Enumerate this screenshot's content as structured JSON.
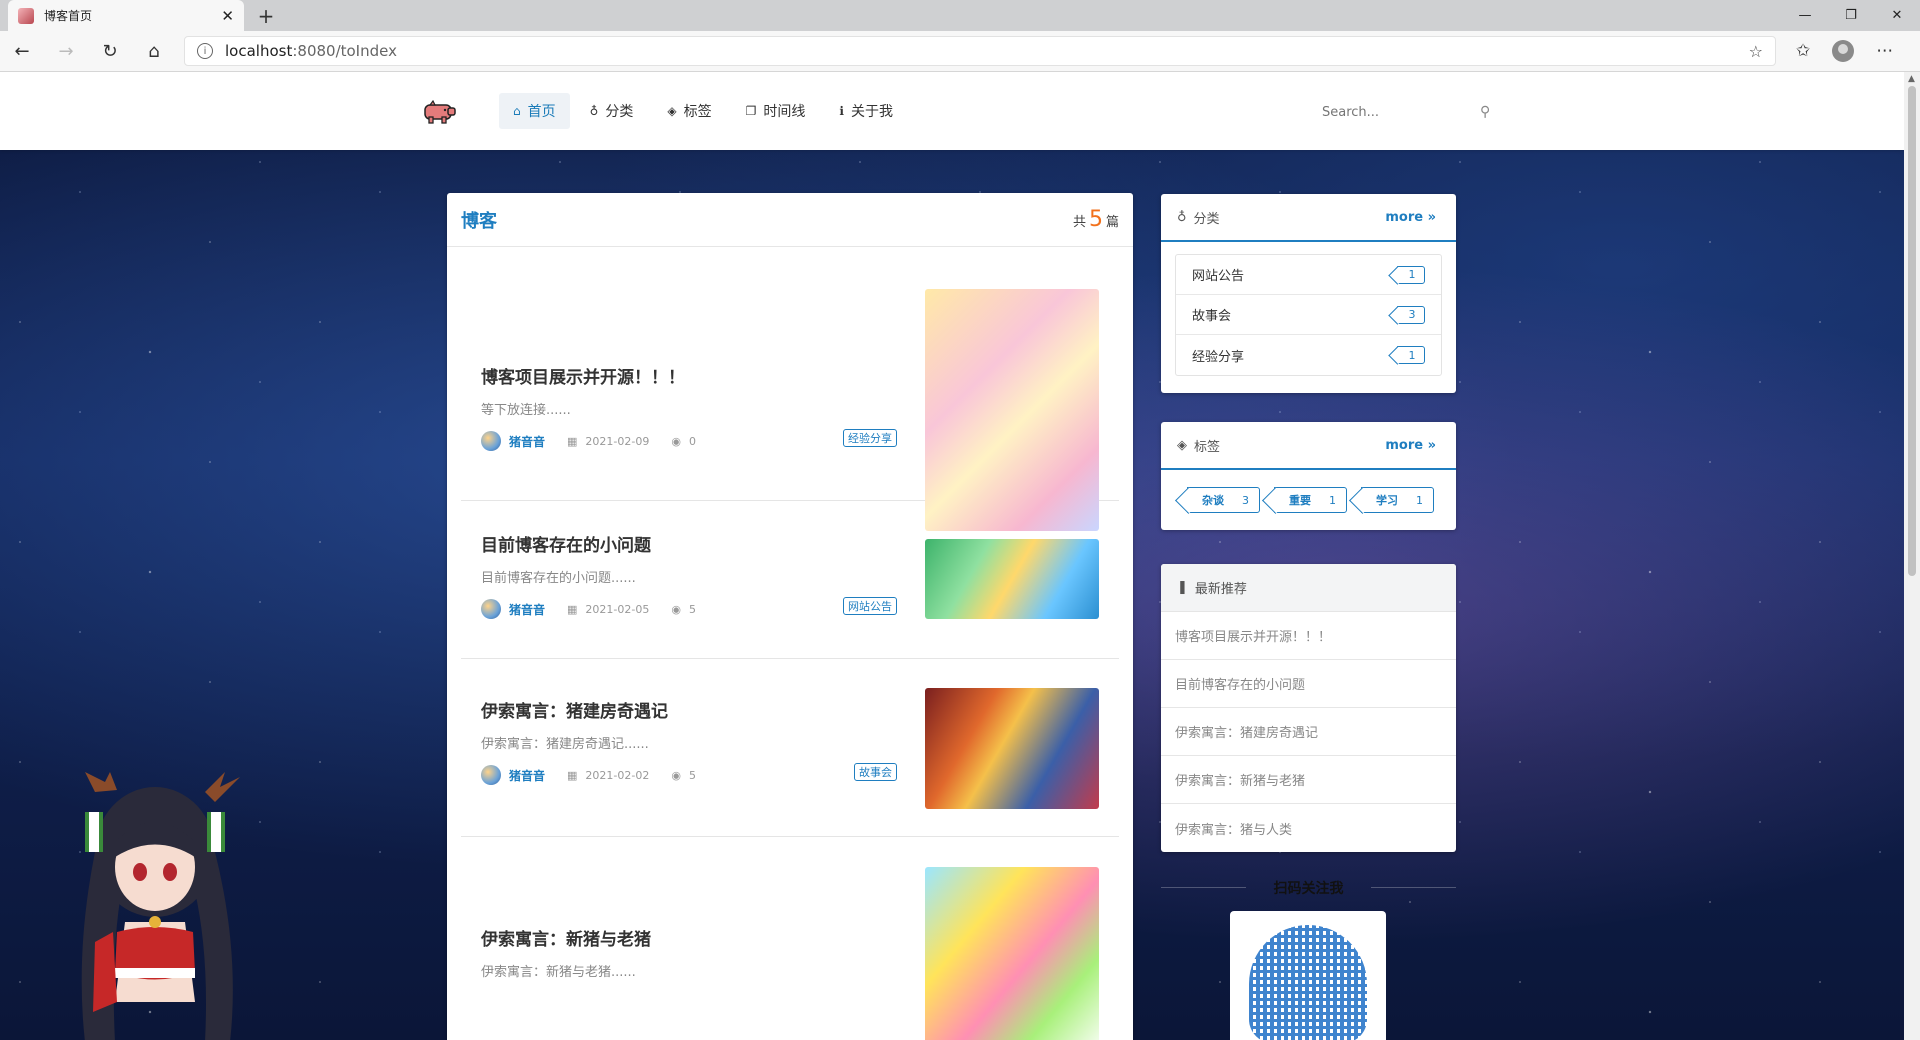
{
  "browser": {
    "tab_title": "博客首页",
    "tab_close": "✕",
    "new_tab": "+",
    "url_host": "localhost",
    "url_path": ":8080/toIndex",
    "controls": {
      "minimize": "—",
      "restore": "❐",
      "close": "✕"
    }
  },
  "nav": {
    "items": [
      {
        "label": "首页",
        "icon": "home-icon",
        "glyph": "⌂",
        "active": true
      },
      {
        "label": "分类",
        "icon": "lightbulb-icon",
        "glyph": "♁",
        "active": false
      },
      {
        "label": "标签",
        "icon": "tags-icon",
        "glyph": "◈",
        "active": false
      },
      {
        "label": "时间线",
        "icon": "clone-icon",
        "glyph": "❐",
        "active": false
      },
      {
        "label": "关于我",
        "icon": "info-icon",
        "glyph": "ℹ",
        "active": false
      }
    ],
    "search_placeholder": "Search..."
  },
  "blog": {
    "title": "博客",
    "count_prefix": "共",
    "count": "5",
    "count_suffix": "篇",
    "posts": [
      {
        "title": "博客项目展示并开源！！！",
        "excerpt": "等下放连接......",
        "author": "猪音音",
        "date": "2021-02-09",
        "views": "0",
        "tag": "经验分享"
      },
      {
        "title": "目前博客存在的小问题",
        "excerpt": "目前博客存在的小问题......",
        "author": "猪音音",
        "date": "2021-02-05",
        "views": "5",
        "tag": "网站公告"
      },
      {
        "title": "伊索寓言：猪建房奇遇记",
        "excerpt": "伊索寓言：猪建房奇遇记......",
        "author": "猪音音",
        "date": "2021-02-02",
        "views": "5",
        "tag": "故事会"
      },
      {
        "title": "伊索寓言：新猪与老猪",
        "excerpt": "伊索寓言：新猪与老猪......",
        "author": "",
        "date": "",
        "views": "",
        "tag": ""
      }
    ]
  },
  "sidebar": {
    "categories": {
      "title": "分类",
      "more": "more",
      "items": [
        {
          "name": "网站公告",
          "count": "1"
        },
        {
          "name": "故事会",
          "count": "3"
        },
        {
          "name": "经验分享",
          "count": "1"
        }
      ]
    },
    "tags": {
      "title": "标签",
      "more": "more",
      "items": [
        {
          "name": "杂谈",
          "count": "3"
        },
        {
          "name": "重要",
          "count": "1"
        },
        {
          "name": "学习",
          "count": "1"
        }
      ]
    },
    "recommend": {
      "title": "最新推荐",
      "items": [
        "博客项目展示并开源！！！",
        "目前博客存在的小问题",
        "伊索寓言：猪建房奇遇记",
        "伊索寓言：新猪与老猪",
        "伊索寓言：猪与人类"
      ]
    },
    "qr_label": "扫码关注我"
  },
  "colors": {
    "accent": "#1f7ec0",
    "count_orange": "#f2711c"
  }
}
